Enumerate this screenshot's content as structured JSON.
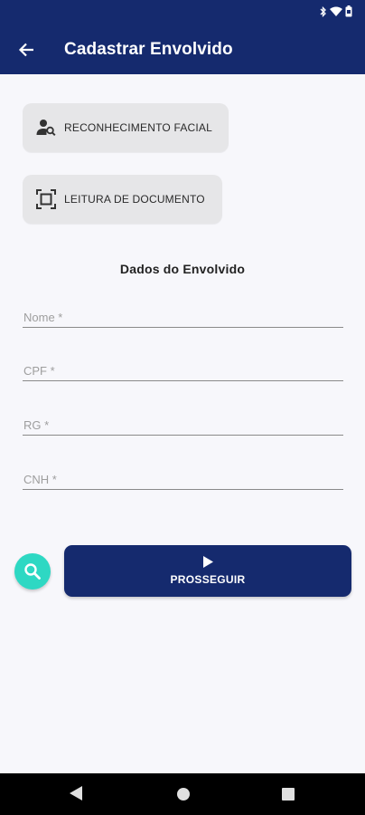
{
  "header": {
    "title": "Cadastrar Envolvido"
  },
  "actions": {
    "facial_label": "RECONHECIMENTO FACIAL",
    "document_label": "LEITURA DE DOCUMENTO"
  },
  "form": {
    "section_title": "Dados do Envolvido",
    "nome_placeholder": "Nome *",
    "cpf_placeholder": "CPF *",
    "rg_placeholder": "RG *",
    "cnh_placeholder": "CNH *"
  },
  "footer": {
    "proceed_label": "PROSSEGUIR"
  },
  "colors": {
    "primary": "#152a6e",
    "accent": "#2ed8c3",
    "action_bg": "#e6e6e8"
  },
  "icons": {
    "back": "arrow-left-icon",
    "facial": "person-search-icon",
    "document": "document-scan-icon",
    "search": "search-icon",
    "play": "play-icon"
  }
}
